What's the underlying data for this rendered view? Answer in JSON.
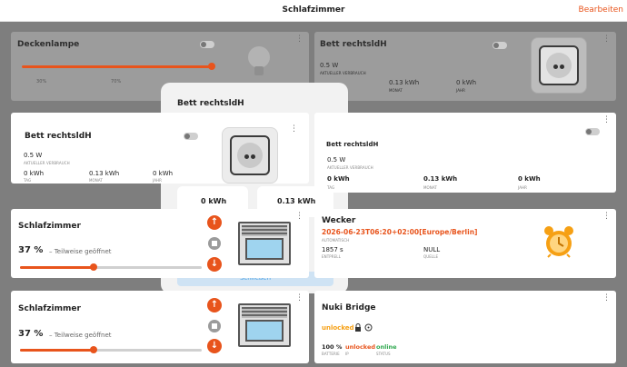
{
  "header": {
    "title": "Schlafzimmer",
    "edit_label": "Bearbeiten"
  },
  "colors": {
    "accent": "#e8541c",
    "green": "#2fa84f",
    "button_blue": "#4aa2e6"
  },
  "background_cards": {
    "lamp": {
      "title": "Deckenlampe",
      "brightness_percent": 100,
      "scale_labels": [
        "30%",
        "70%"
      ]
    },
    "plug_top_right": {
      "title": "Bett rechtsldH",
      "power": "0.5 W",
      "power_label": "AKTUELLER VERBRAUCH",
      "month_value": "0.13 kWh",
      "month_label": "MONAT",
      "year_value": "0 kWh",
      "year_label": "JAHR"
    }
  },
  "dialog": {
    "title": "Bett rechtsldH",
    "tile_left": "0 kWh",
    "tile_right": "0.13 kWh",
    "close_label": "Schließen"
  },
  "plug_card_left": {
    "title": "Bett rechtsldH",
    "power": "0.5 W",
    "power_label": "AKTUELLER VERBRAUCH",
    "stats": [
      {
        "value": "0 kWh",
        "label": "TAG"
      },
      {
        "value": "0.13 kWh",
        "label": "MONAT"
      },
      {
        "value": "0 kWh",
        "label": "JAHR"
      }
    ]
  },
  "plug_card_right": {
    "title": "Bett rechtsldH",
    "power": "0.5 W",
    "power_label": "AKTUELLER VERBRAUCH",
    "stats": [
      {
        "value": "0 kWh",
        "label": "TAG"
      },
      {
        "value": "0.13 kWh",
        "label": "MONAT"
      },
      {
        "value": "0 kWh",
        "label": "JAHR"
      }
    ]
  },
  "cover_card_1": {
    "title": "Schlafzimmer",
    "percent": "37 %",
    "state": "– Teilweise geöffnet",
    "position_percent": 37
  },
  "cover_card_2": {
    "title": "Schlafzimmer",
    "percent": "37 %",
    "state": "– Teilweise geöffnet",
    "position_percent": 37
  },
  "alarm_card": {
    "title": "Wecker",
    "datetime": "2026-06-23T06:20+02:00[Europe/Berlin]",
    "datetime_label": "AUTOMATISCH",
    "left_value": "1857 s",
    "left_label": "ENTPRELL",
    "right_value": "NULL",
    "right_label": "QUELLE"
  },
  "nuki_card": {
    "title": "Nuki Bridge",
    "lock_state": "unlocked",
    "stats": [
      {
        "value": "100 %",
        "label": "BATTERIE"
      },
      {
        "value": "unlocked",
        "label": "IP"
      },
      {
        "value": "online",
        "label": "STATUS"
      }
    ]
  }
}
